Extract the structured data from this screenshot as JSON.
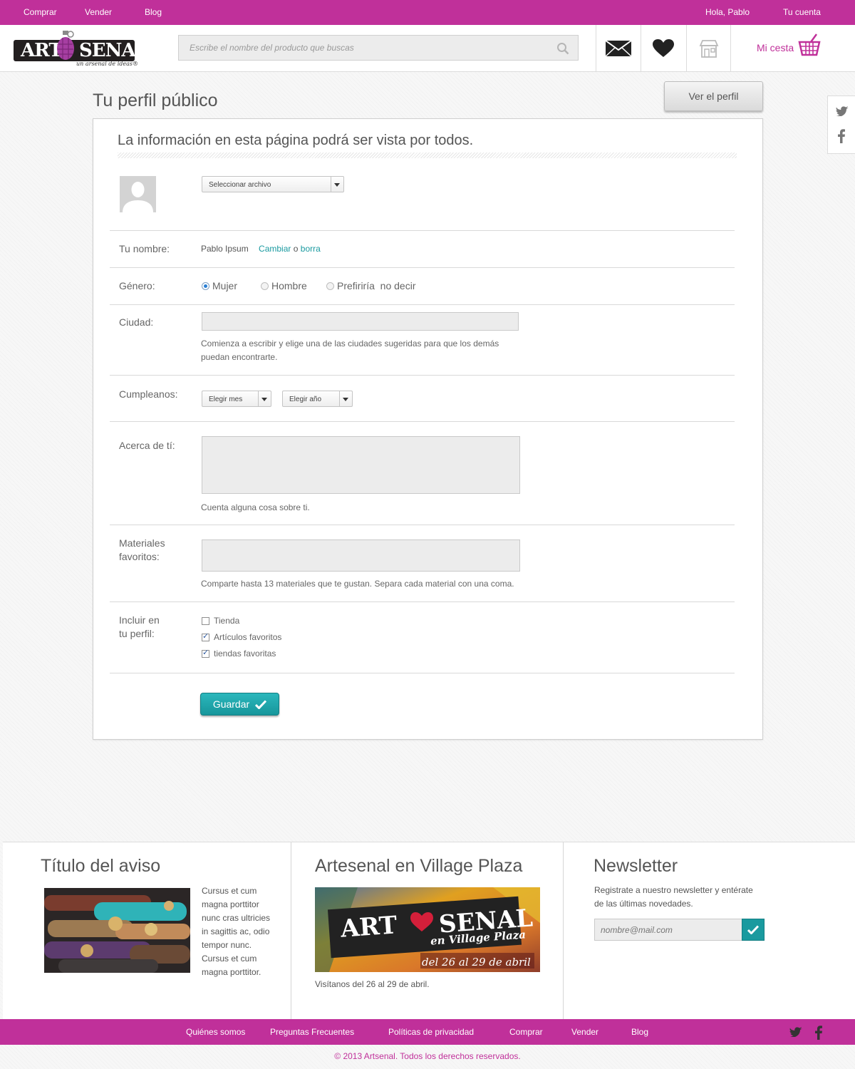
{
  "topnav": {
    "buy": "Comprar",
    "sell": "Vender",
    "blog": "Blog",
    "greeting": "Hola, Pablo",
    "account": "Tu cuenta"
  },
  "logo": {
    "art": "ART",
    "senal": "SENAL",
    "tagline": "un arsenal de ideas®"
  },
  "search": {
    "placeholder": "Escribe el nombre del producto que buscas"
  },
  "cart": {
    "label": "Mi cesta"
  },
  "page": {
    "title": "Tu perfil público",
    "view_profile": "Ver el perfil"
  },
  "form": {
    "lead": "La información en esta página podrá ser vista por todos.",
    "file_select": "Seleccionar archivo",
    "name_label": "Tu nombre:",
    "name_value": "Pablo Ipsum",
    "change_link": "Cambiar",
    "or_text": "o",
    "delete_link": "borra",
    "gender_label": "Género:",
    "gender_options": [
      "Mujer",
      "Hombre",
      "Prefiriría  no decir"
    ],
    "city_label": "Ciudad:",
    "city_help": [
      "Comienza a escribir y elige una de las ciudades sugeridas para que los demás",
      "puedan encontrarte."
    ],
    "birthday_label": "Cumpleanos:",
    "month_select": "Elegir mes",
    "year_select": "Elegir año",
    "about_label": "Acerca de tí:",
    "about_help": "Cuenta alguna cosa sobre ti.",
    "materials_label": [
      "Materiales",
      "favoritos:"
    ],
    "materials_help": "Comparte hasta 13 materiales que te gustan. Separa cada material con una coma.",
    "include_label": [
      "Incluir en",
      "tu perfil:"
    ],
    "include_options": [
      {
        "label": "Tienda",
        "checked": false
      },
      {
        "label": "Artículos favoritos",
        "checked": true
      },
      {
        "label": "tiendas favoritas",
        "checked": true
      }
    ],
    "save": "Guardar"
  },
  "footer": {
    "notice_title": "Título del aviso",
    "notice_text": [
      "Cursus et cum",
      "magna porttitor",
      "nunc cras ultricies",
      "in sagittis ac, odio",
      "tempor nunc.",
      "Cursus et cum",
      "magna porttitor."
    ],
    "village_title": "Artesenal en Village Plaza",
    "village_banner": {
      "art": "ART",
      "senal": "SENAL",
      "sub": "en Village Plaza",
      "dates": "del 26 al 29 de abril"
    },
    "village_text": "Visítanos del 26 al 29 de abril.",
    "newsletter_title": "Newsletter",
    "newsletter_text": [
      "Registrate a nuestro newsletter y entérate",
      "de las últimas novedades."
    ],
    "newsletter_placeholder": "nombre@mail.com"
  },
  "bottomnav": [
    "Quiénes somos",
    "Preguntas Frecuentes",
    "Políticas de privacidad",
    "Comprar",
    "Vender",
    "Blog"
  ],
  "copyright": "© 2013 Artsenal. Todos los derechos reservados.",
  "colors": {
    "brand": "#c0309a",
    "accent": "#1a9aa0"
  }
}
